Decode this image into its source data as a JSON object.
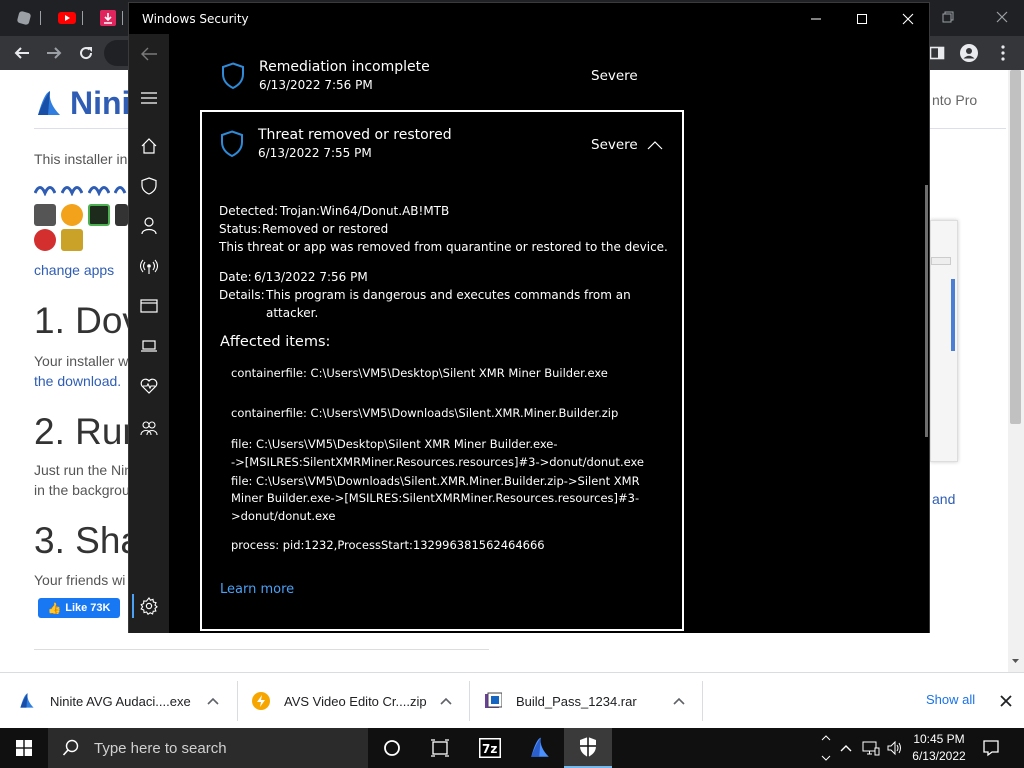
{
  "browser": {
    "tabs": [
      {
        "icon": "gear-tab-icon"
      },
      {
        "icon": "youtube-icon"
      },
      {
        "icon": "download-tab-icon"
      }
    ],
    "nav_icons": [
      "back-icon",
      "forward-icon",
      "reload-icon"
    ]
  },
  "ninite_page": {
    "logo_text": "Nini",
    "header_link_partial": "nto Pro",
    "intro_partial": "This installer in",
    "change_apps": "change apps",
    "step1_partial": "1. Dov",
    "step1_text_partial": "Your installer w",
    "step1_link_partial": "the download.",
    "step2_partial": "2. Rur",
    "step2_text1_partial": "Just run the Nin",
    "step2_text2_partial": "in the backgrou",
    "step2_link_partial": "and",
    "step3_partial": "3. Sha",
    "step3_text_partial": "Your friends wi",
    "fb_like": "Like 73K"
  },
  "downloads": {
    "items": [
      {
        "name": "Ninite AVG Audaci....exe"
      },
      {
        "name": "AVS Video Edito Cr....zip"
      },
      {
        "name": "Build_Pass_1234.rar"
      }
    ],
    "show_all": "Show all"
  },
  "taskbar": {
    "search_placeholder": "Type here to search",
    "time": "10:45 PM",
    "date": "6/13/2022"
  },
  "window": {
    "title": "Windows Security",
    "threats": [
      {
        "title": "Remediation incomplete",
        "date": "6/13/2022 7:56 PM",
        "severity": "Severe"
      },
      {
        "title": "Threat removed or restored",
        "date": "6/13/2022 7:55 PM",
        "severity": "Severe"
      }
    ],
    "details": {
      "detected_label": "Detected:",
      "detected_value": "Trojan:Win64/Donut.AB!MTB",
      "status_label": "Status:",
      "status_value": "Removed or restored",
      "status_desc": "This threat or app was removed from quarantine or restored to the device.",
      "date_label": "Date:",
      "date_value": "6/13/2022 7:56 PM",
      "details_label": "Details:",
      "details_line1": "This program is dangerous and executes commands from an",
      "details_line2": "attacker.",
      "affected_heading": "Affected items:",
      "items": [
        "containerfile: C:\\Users\\VM5\\Desktop\\Silent XMR Miner Builder.exe",
        "containerfile: C:\\Users\\VM5\\Downloads\\Silent.XMR.Miner.Builder.zip",
        "file: C:\\Users\\VM5\\Desktop\\Silent XMR Miner Builder.exe-",
        "->[MSILRES:SilentXMRMiner.Resources.resources]#3->donut/donut.exe",
        "file: C:\\Users\\VM5\\Downloads\\Silent.XMR.Miner.Builder.zip->Silent XMR",
        "Miner Builder.exe->[MSILRES:SilentXMRMiner.Resources.resources]#3-",
        ">donut/donut.exe",
        "process: pid:1232,ProcessStart:132996381562464666"
      ],
      "learn_more": "Learn more"
    }
  }
}
